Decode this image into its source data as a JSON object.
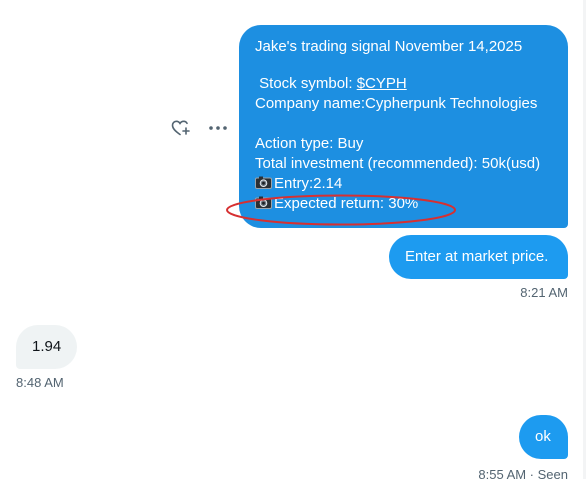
{
  "messages": {
    "signal": {
      "line1": "Jake's trading signal November 14,2025",
      "stock_label": "Stock symbol: ",
      "stock_symbol": "$CYPH",
      "company_line": "Company name:Cypherpunk Technologies",
      "action_line": "Action type: Buy",
      "investment_line": "Total investment (recommended): 50k(usd)",
      "entry_line": "Entry:2.14",
      "return_line": "Expected return: 30%",
      "line_icon": "camera-icon"
    },
    "market": "Enter at market price.",
    "reply_in": "1.94",
    "ok": "ok"
  },
  "timestamps": {
    "t1": "8:21 AM",
    "t2": "8:48 AM",
    "t3": "8:55 AM · Seen"
  },
  "icons": {
    "react": "add-reaction-heart-icon",
    "more": "more-options-icon"
  },
  "colors": {
    "outgoing_bubble": "#1d9bf0",
    "incoming_bubble": "#eff3f4",
    "annotation": "#d63031",
    "timestamp": "#536471"
  }
}
